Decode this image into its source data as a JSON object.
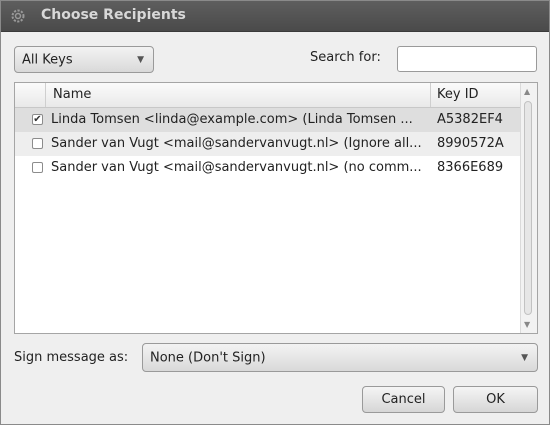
{
  "window": {
    "title": "Choose Recipients"
  },
  "filter": {
    "selected": "All Keys"
  },
  "search": {
    "label": "Search for:",
    "value": ""
  },
  "table": {
    "columns": [
      "Name",
      "Key ID"
    ],
    "rows": [
      {
        "checked": true,
        "name": "Linda Tomsen <linda@example.com> (Linda Tomsen ...",
        "key_id": "A5382EF4"
      },
      {
        "checked": false,
        "name": "Sander van Vugt <mail@sandervanvugt.nl> (Ignore all...",
        "key_id": "8990572A"
      },
      {
        "checked": false,
        "name": "Sander van Vugt <mail@sandervanvugt.nl> (no comm...",
        "key_id": "8366E689"
      }
    ]
  },
  "sign": {
    "label": "Sign message as:",
    "selected": "None (Don't Sign)"
  },
  "buttons": {
    "cancel": "Cancel",
    "ok": "OK"
  },
  "icons": {
    "title": "gear-icon",
    "dropdown": "chevron-down-icon",
    "checkbox": "checkmark-icon"
  }
}
